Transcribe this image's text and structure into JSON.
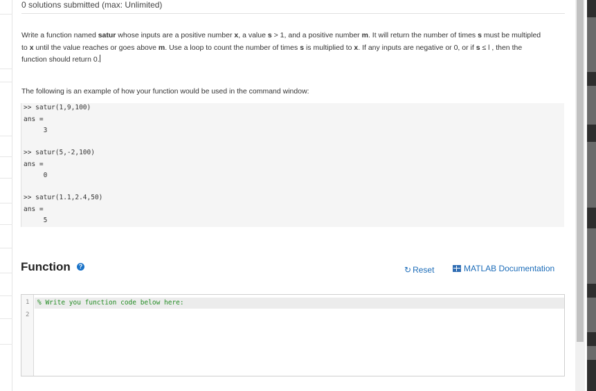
{
  "status": {
    "submitted_text": "0 solutions submitted (max: Unlimited)"
  },
  "problem": {
    "p1": "Write a function named ",
    "fname": "satur",
    "p2": " whose inputs are a positive number ",
    "x": "x",
    "p3": ", a value ",
    "s": "s",
    "p4": " > 1, and a positive number ",
    "m": "m",
    "p5": ". It will return the number of times ",
    "p6": " must be multipled to ",
    "p7": " until the value reaches or goes above ",
    "p8": ". Use a loop to count the number of times ",
    "p9": " is multiplied to ",
    "p10": ". If any inputs are negative or 0, or if ",
    "p11": " ≤ l , then the function should return 0."
  },
  "example": {
    "intro": "The following is an example of how your function would be used in the command window:",
    "lines": [
      ">> satur(1,9,100)",
      "ans =",
      "     3",
      ">> satur(5,-2,100)",
      "ans =",
      "     0",
      ">> satur(1.1,2.4,50)",
      "ans =",
      "     5"
    ]
  },
  "function_section": {
    "title": "Function",
    "help_icon": "question-circle-icon",
    "reset_label": "Reset",
    "reset_icon": "refresh-icon",
    "doc_label": "MATLAB Documentation",
    "doc_icon": "book-icon"
  },
  "editor": {
    "line_numbers": [
      "1",
      "2"
    ],
    "lines": [
      "% Write you function code below here:",
      ""
    ]
  },
  "colors": {
    "link": "#1a6bb8",
    "comment": "#228b22",
    "code_bg": "#f5f5f5"
  }
}
